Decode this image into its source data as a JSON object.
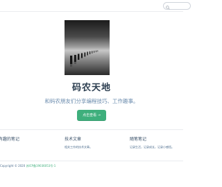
{
  "header": {
    "search_placeholder": ""
  },
  "hero": {
    "image_icon": "long-exposure-pier-image",
    "title": "码农天地",
    "description": "和码农朋友们分享编程技巧、工作趣事。",
    "cta_label": "点击查看 →"
  },
  "features": [
    {
      "title": "有趣的笔记",
      "details": ""
    },
    {
      "title": "技术文章",
      "details": "相关工作的技术文章。"
    },
    {
      "title": "随笔笔记",
      "details": "记录生活，记录成长，记录小感悟。"
    }
  ],
  "footer": {
    "copyright": "Copyright © 2020",
    "link_text": "苏ICP备19036053号-1"
  },
  "colors": {
    "accent": "#3eaf7c",
    "text": "#2c3e50",
    "muted": "#6a8bad"
  }
}
